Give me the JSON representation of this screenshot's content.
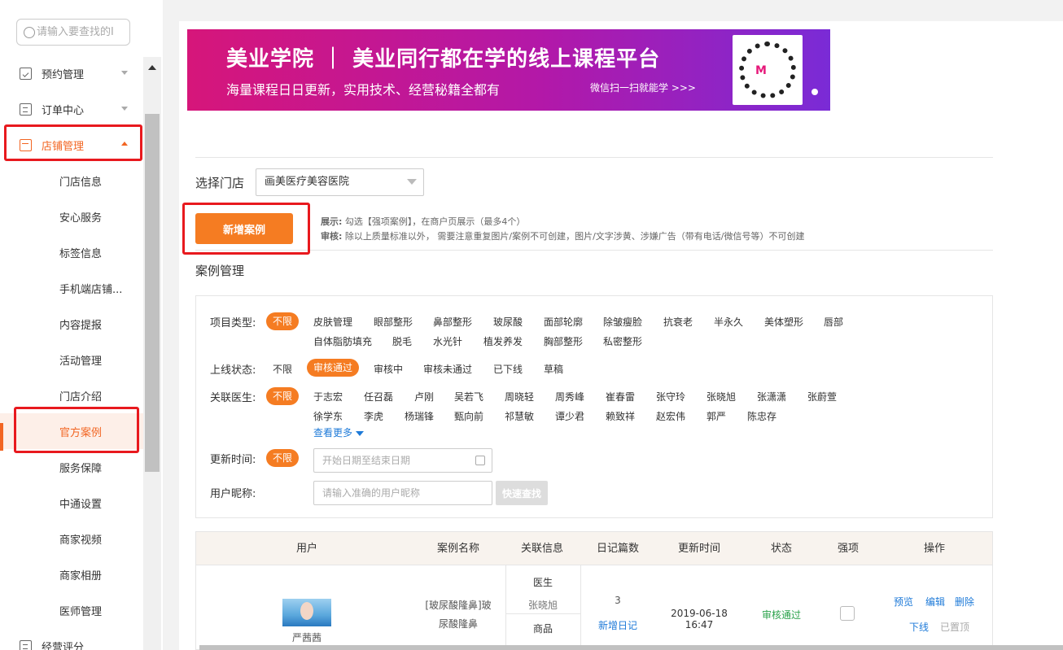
{
  "sidebar": {
    "search_placeholder": "请输入要查找的I",
    "items": [
      {
        "label": "预约管理"
      },
      {
        "label": "订单中心"
      },
      {
        "label": "店铺管理"
      },
      {
        "label": "门店信息"
      },
      {
        "label": "安心服务"
      },
      {
        "label": "标签信息"
      },
      {
        "label": "手机端店铺..."
      },
      {
        "label": "内容提报"
      },
      {
        "label": "活动管理"
      },
      {
        "label": "门店介绍"
      },
      {
        "label": "官方案例"
      },
      {
        "label": "服务保障"
      },
      {
        "label": "中通设置"
      },
      {
        "label": "商家视频"
      },
      {
        "label": "商家相册"
      },
      {
        "label": "医师管理"
      },
      {
        "label": "经营评分"
      }
    ]
  },
  "banner": {
    "title": "美业学院 ｜ 美业同行都在学的线上课程平台",
    "subtitle": "海量课程日日更新，实用技术、经营秘籍全都有",
    "cta": "微信扫一扫就能学 >>>",
    "qr_logo": "M"
  },
  "store": {
    "label": "选择门店",
    "selected": "画美医疗美容医院"
  },
  "add_button": "新增案例",
  "notes": {
    "show_label": "展示:",
    "show_text": " 勾选【强项案例】，在商户页展示（最多4个）",
    "review_label": "审核:",
    "review_text": " 除以上质量标准以外， 需要注意重复图片/案例不可创建，图片/文字涉黄、涉嫌广告（带有电话/微信号等）不可创建"
  },
  "section_title": "案例管理",
  "filters": {
    "project_label": "项目类型:",
    "status_label": "上线状态:",
    "doctor_label": "关联医生:",
    "time_label": "更新时间:",
    "nick_label": "用户昵称:",
    "unlimited": "不限",
    "projects": [
      "皮肤管理",
      "眼部整形",
      "鼻部整形",
      "玻尿酸",
      "面部轮廓",
      "除皱瘦脸",
      "抗衰老",
      "半永久",
      "美体塑形",
      "唇部",
      "自体脂肪填充",
      "脱毛",
      "水光针",
      "植发养发",
      "胸部整形",
      "私密整形"
    ],
    "statuses": [
      "不限",
      "审核通过",
      "审核中",
      "审核未通过",
      "已下线",
      "草稿"
    ],
    "doctors": [
      "于志宏",
      "任召磊",
      "卢刚",
      "吴若飞",
      "周晓轻",
      "周秀峰",
      "崔春雷",
      "张守玲",
      "张晓旭",
      "张潇潇",
      "张蔚萱",
      "徐学东",
      "李虎",
      "杨瑞锋",
      "甄向前",
      "祁慧敏",
      "谭少君",
      "赖致祥",
      "赵宏伟",
      "郭严",
      "陈忠存"
    ],
    "more": "查看更多",
    "date_placeholder": "开始日期至结束日期",
    "nick_placeholder": "请输入准确的用户昵称",
    "quick_search": "快速查找"
  },
  "table": {
    "headers": [
      "用户",
      "案例名称",
      "关联信息",
      "日记篇数",
      "更新时间",
      "状态",
      "强项",
      "操作"
    ],
    "row": {
      "user": "严茜茜",
      "case_name_1": "[玻尿酸隆鼻]玻",
      "case_name_2": "尿酸隆鼻",
      "rel_doctor_label": "医生",
      "rel_doctor": "张晓旭",
      "rel_goods_label": "商品",
      "diary_count": "3",
      "add_diary": "新增日记",
      "updated": "2019-06-18 16:47",
      "status": "审核通过",
      "ops": [
        "预览",
        "编辑",
        "删除",
        "下线",
        "已置顶"
      ]
    }
  },
  "colors": {
    "accent": "#f57c22",
    "link": "#1e7ad8",
    "success": "#2aa24a",
    "highlight": "#e8191e"
  }
}
